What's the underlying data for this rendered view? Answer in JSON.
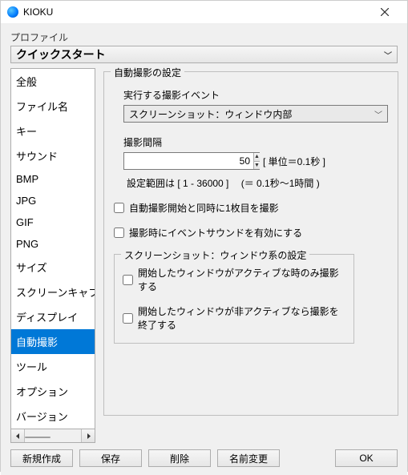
{
  "window": {
    "title": "KIOKU"
  },
  "profile": {
    "label": "プロファイル",
    "selected": "クイックスタート"
  },
  "sidebar": {
    "items": [
      {
        "label": "全般"
      },
      {
        "label": "ファイル名"
      },
      {
        "label": "キー"
      },
      {
        "label": "サウンド"
      },
      {
        "label": "BMP"
      },
      {
        "label": "JPG"
      },
      {
        "label": "GIF"
      },
      {
        "label": "PNG"
      },
      {
        "label": "サイズ"
      },
      {
        "label": "スクリーンキャプ"
      },
      {
        "label": "ディスプレイ"
      },
      {
        "label": "自動撮影"
      },
      {
        "label": "ツール"
      },
      {
        "label": "オプション"
      },
      {
        "label": "バージョン"
      }
    ],
    "selected_index": 11
  },
  "settings": {
    "group_title": "自動撮影の設定",
    "event_label": "実行する撮影イベント",
    "event_selected": "スクリーンショット：ウィンドウ内部",
    "interval_label": "撮影間隔",
    "interval_value": "50",
    "interval_unit": "[ 単位＝0.1秒 ]",
    "interval_range": "設定範囲は [ 1 - 36000 ] 　(＝ 0.1秒～1時間 )",
    "chk_first_shot": "自動撮影開始と同時に1枚目を撮影",
    "chk_sound": "撮影時にイベントサウンドを有効にする",
    "subgroup_title": "スクリーンショット：ウィンドウ系の設定",
    "chk_active_only": "開始したウィンドウがアクティブな時のみ撮影する",
    "chk_stop_inactive": "開始したウィンドウが非アクティブなら撮影を終了する"
  },
  "buttons": {
    "new": "新規作成",
    "save": "保存",
    "delete": "削除",
    "rename": "名前変更",
    "ok": "OK"
  }
}
